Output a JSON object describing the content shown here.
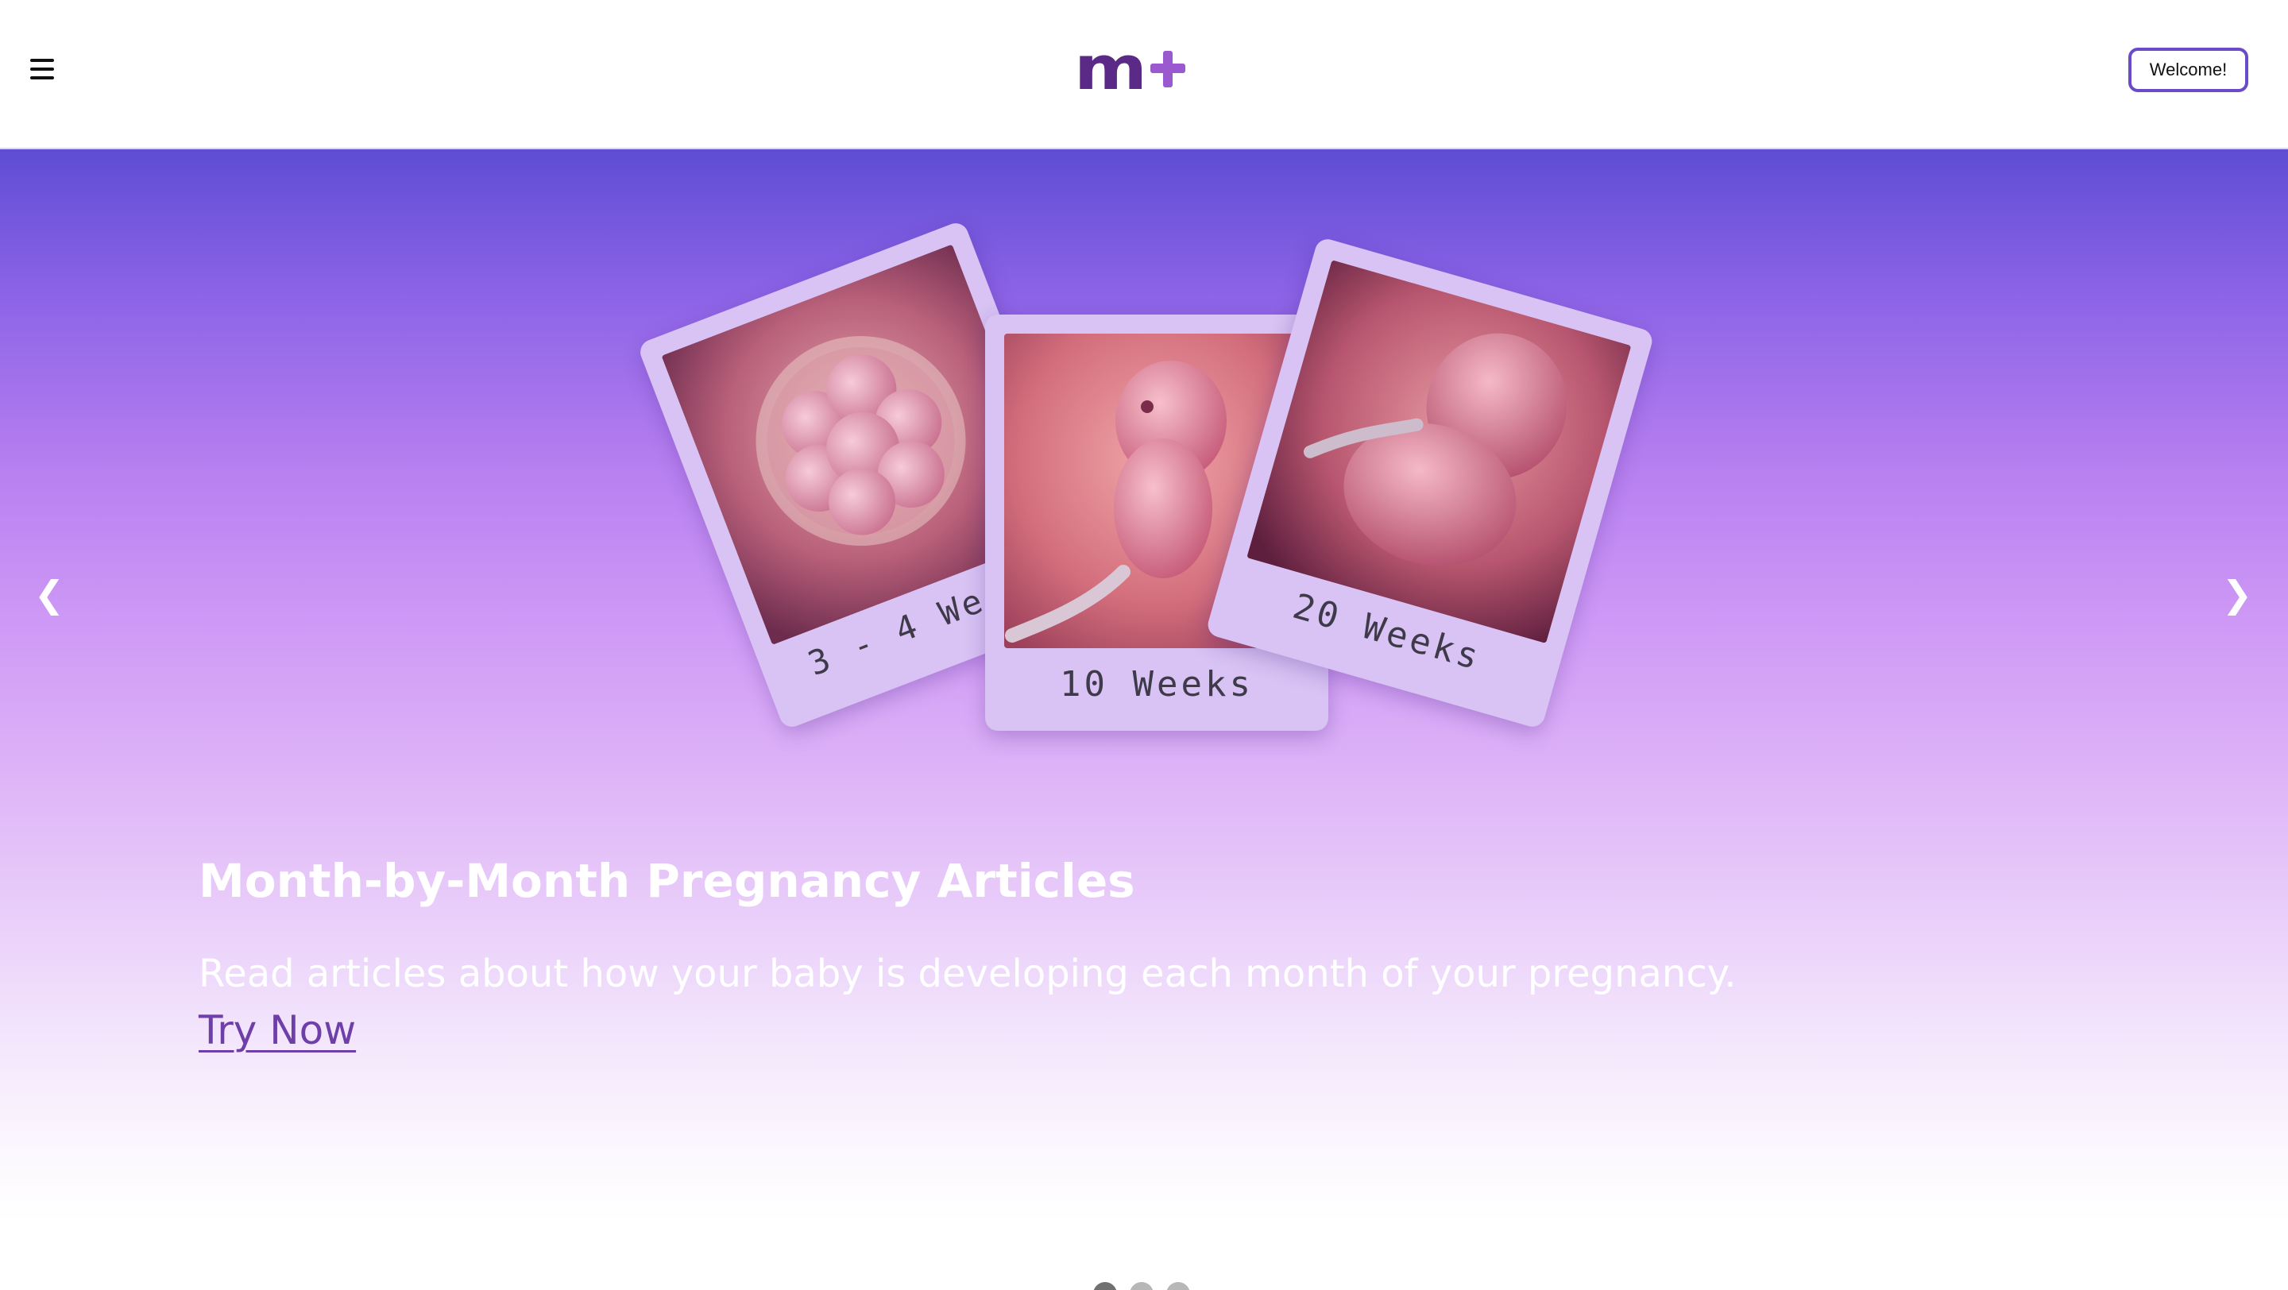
{
  "header": {
    "menu_icon": "hamburger-menu-icon",
    "logo": {
      "text": "m+",
      "colors": {
        "m": "#5b2a86",
        "plus": "#9b59d0"
      }
    },
    "welcome_button_label": "Welcome!",
    "welcome_button_border": "#6a4bc8"
  },
  "carousel": {
    "prev_icon": "chevron-left-icon",
    "next_icon": "chevron-right-icon",
    "prev_glyph": "❮",
    "next_glyph": "❯",
    "cards": [
      {
        "caption": "3 - 4 Weeks",
        "image": "early-embryo-cell-cluster"
      },
      {
        "caption": "10 Weeks",
        "image": "fetus-10-weeks"
      },
      {
        "caption": "20 Weeks",
        "image": "fetus-20-weeks"
      }
    ],
    "title": "Month-by-Month Pregnancy Articles",
    "description": "Read articles about how your baby is developing each month of your pregnancy.",
    "cta_label": "Try Now",
    "slides_total": 3,
    "active_slide": 1,
    "colors": {
      "gradient_top": "#5e4dd4",
      "gradient_mid": "#b77ff0",
      "cta": "#6e3fa8",
      "dot_active": "#707070",
      "dot_inactive": "#b7b7b7"
    }
  }
}
